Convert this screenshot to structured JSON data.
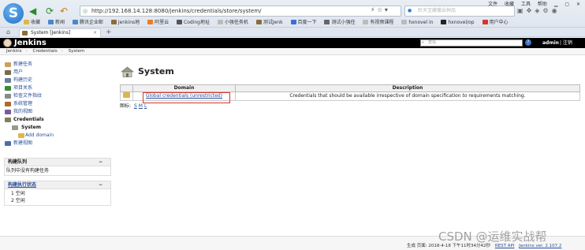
{
  "browser": {
    "url": "http://192.168.14.128:8080/jenkins/credentials/store/system/",
    "search_placeholder": "聆天宝藏撒出神品",
    "menu": [
      "文件",
      "收藏",
      "工具",
      "帮助"
    ],
    "bookmarks": [
      "收藏",
      "新闻",
      "腾讯企业邮",
      "Jenkins地",
      "阿里云",
      "Coding地址",
      "小强任务机",
      "测试Jenk",
      "百度一下",
      "测试小强任",
      "有视频课程",
      "hxnovel in",
      "hxnovel/op",
      "用户中心"
    ],
    "tab_title": "System [Jenkins]",
    "tab_new": "+"
  },
  "header": {
    "brand": "Jenkins",
    "search_placeholder": "查找",
    "help": "?",
    "user": "admin",
    "logout": "| 注销"
  },
  "breadcrumbs": [
    "Jenkins",
    "Credentials",
    "System"
  ],
  "sidebar": {
    "tasks": [
      {
        "label": "新建任务",
        "color": "#c9a15b"
      },
      {
        "label": "用户",
        "color": "#7a6a4a"
      },
      {
        "label": "构建历史",
        "color": "#6a7f9a"
      },
      {
        "label": "项目关系",
        "color": "#3a8a3a"
      },
      {
        "label": "检查文件指纹",
        "color": "#8a8a8a"
      },
      {
        "label": "系统管理",
        "color": "#b06a2a"
      },
      {
        "label": "我的视图",
        "color": "#7a5a9a"
      },
      {
        "label": "Credentials",
        "color": "#7f7f5a"
      }
    ],
    "sub_system": "System",
    "sub_add_domain": "Add domain",
    "new_view": "新建视图"
  },
  "build_queue": {
    "title": "构建队列",
    "collapse": "−",
    "empty_text": "队列中没有构建任务"
  },
  "executor_status": {
    "title": "构建执行状态",
    "collapse": "−",
    "rows": [
      "1 空闲",
      "2 空闲"
    ]
  },
  "main": {
    "title": "System",
    "table_headers": [
      "Domain",
      "Description"
    ],
    "rows": [
      {
        "domain": "Global credentials (unrestricted)",
        "description": "Credentials that should be available irrespective of domain specification to requirements matching."
      }
    ],
    "icon_label": "图标:",
    "icon_sizes": [
      "S",
      "M",
      "L"
    ]
  },
  "footer": {
    "generated": "生成 页面: 2018-4-18 下午11时34分42秒",
    "rest_api": "REST API",
    "version": "Jenkins ver. 2.107.2"
  },
  "watermark": "CSDN @运维实战帮",
  "colors": {
    "link": "#2a4f9b",
    "header_bg": "#000000",
    "highlight": "#d9342b"
  }
}
